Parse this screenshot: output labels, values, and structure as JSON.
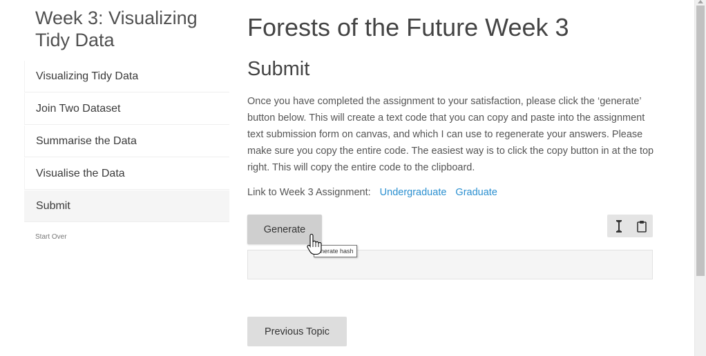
{
  "sidebar": {
    "title": "Week 3: Visualizing Tidy Data",
    "items": [
      {
        "label": "Visualizing Tidy Data"
      },
      {
        "label": "Join Two Dataset"
      },
      {
        "label": "Summarise the Data"
      },
      {
        "label": "Visualise the Data"
      },
      {
        "label": "Submit"
      }
    ],
    "active_item": "Submit",
    "start_over": "Start Over"
  },
  "main": {
    "title": "Forests of the Future Week 3",
    "section_title": "Submit",
    "instructions": "Once you have completed the assignment to your satisfaction, please click the ‘generate’ button below. This will create a text code that you can copy and paste into the assignment text submission form on canvas, and which I can use to regenerate your answers. Please make sure you copy the entire code. The easiest way is to click the copy button in at the top right. This will copy the entire code to the clipboard.",
    "assignment_label": "Link to Week 3 Assignment:",
    "links": {
      "undergraduate": "Undergraduate",
      "graduate": "Graduate"
    },
    "generate_label": "Generate",
    "generate_tooltip": "enerate hash",
    "code_value": "",
    "toolbar_icons": [
      "text-cursor-icon",
      "clipboard-icon"
    ],
    "previous_label": "Previous Topic"
  },
  "colors": {
    "link": "#2a8fd0",
    "button_bg": "#dddddd",
    "active_bg": "#f5f5f5"
  }
}
